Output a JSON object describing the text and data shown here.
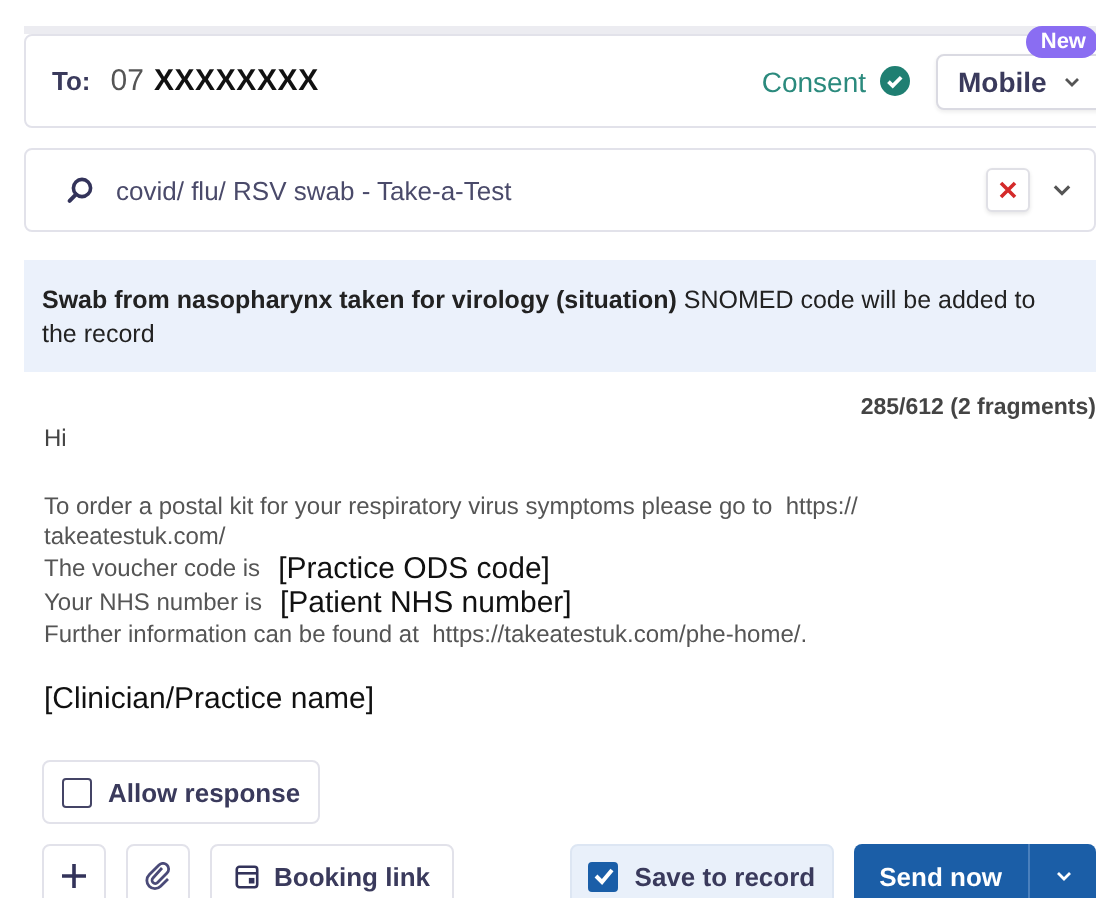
{
  "recipient": {
    "label": "To:",
    "prefix": "07",
    "number": "XXXXXXXX",
    "consent": "Consent",
    "consent_given": true,
    "channel": "Mobile",
    "badge": "New"
  },
  "template_search": {
    "value": "covid/ flu/ RSV swab - Take-a-Test"
  },
  "banner": "**Swab from nasopharynx taken for virology (situation)** SNOMED code will be added to the record",
  "message": {
    "counter": "285/612 (2 fragments)",
    "greeting": "Hi",
    "lines": [
      {
        "text": "To order a postal kit for your respiratory virus symptoms please go to  https://"
      },
      {
        "text": "takeatestuk.com/"
      },
      {
        "text": "The voucher code is",
        "placeholder": "[Practice ODS code]"
      },
      {
        "text": "Your NHS number is",
        "placeholder": "[Patient NHS number]"
      },
      {
        "text": "Further information can be found at  https://takeatestuk.com/phe-home/."
      }
    ],
    "signature": "[Clinician/Practice name]"
  },
  "allow_response": {
    "label": "Allow response",
    "checked": false
  },
  "toolbar": {
    "booking_link": "Booking link",
    "save_to_record": {
      "label": "Save to record",
      "checked": true
    },
    "send": "Send now"
  }
}
